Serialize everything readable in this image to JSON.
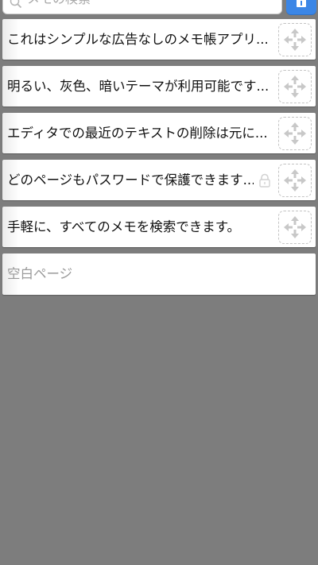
{
  "search": {
    "placeholder": "メモの検索",
    "icon": "search-icon"
  },
  "header": {
    "add_button_icon": "add-note-icon",
    "accent": "#3b86e6"
  },
  "notes": [
    {
      "title": "これはシンプルな広告なしのメモ帳アプリ...",
      "locked": false
    },
    {
      "title": "明るい、灰色、暗いテーマが利用可能です...",
      "locked": false
    },
    {
      "title": "エディタでの最近のテキストの削除は元に...",
      "locked": false
    },
    {
      "title": "どのページもパスワードで保護できます...",
      "locked": true
    },
    {
      "title": "手軽に、すべてのメモを検索できます。",
      "locked": false
    }
  ],
  "empty_page": {
    "label": "空白ページ"
  }
}
